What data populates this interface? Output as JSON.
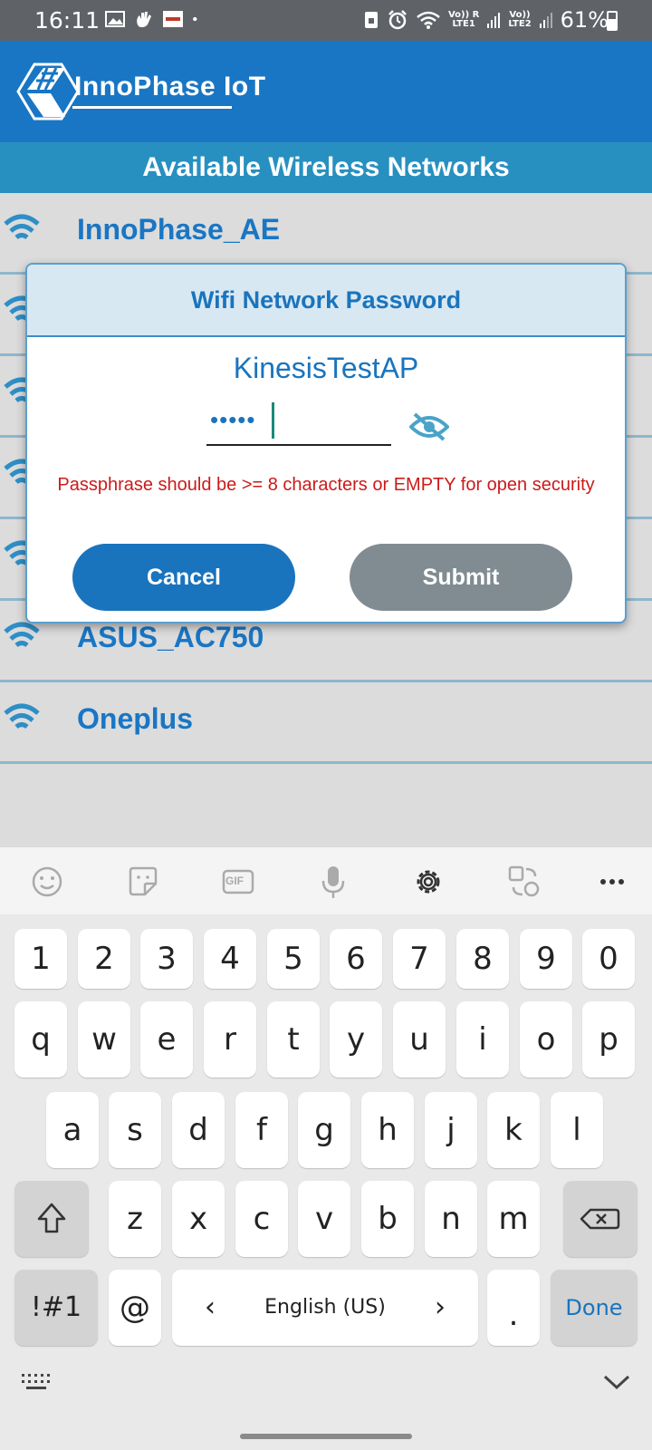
{
  "status_bar": {
    "time": "16:11",
    "net1": "Vo)) R",
    "net1_sub": "LTE1",
    "net2": "Vo))",
    "net2_sub": "LTE2",
    "battery": "61%"
  },
  "header": {
    "brand": "InnoPhase IoT",
    "section_title": "Available Wireless Networks"
  },
  "networks": [
    {
      "name": "InnoPhase_AE"
    },
    {
      "name": ""
    },
    {
      "name": ""
    },
    {
      "name": ""
    },
    {
      "name": ""
    },
    {
      "name": "ASUS_AC750"
    },
    {
      "name": "Oneplus"
    }
  ],
  "dialog": {
    "title": "Wifi Network Password",
    "ssid": "KinesisTestAP",
    "password_masked": "•••••",
    "error": "Passphrase should be >= 8 characters or EMPTY for open security",
    "cancel_label": "Cancel",
    "submit_label": "Submit"
  },
  "keyboard": {
    "toolbar_icons": [
      "emoji-icon",
      "sticker-icon",
      "gif-icon",
      "mic-icon",
      "settings-icon",
      "translate-icon",
      "more-icon"
    ],
    "gif_label": "GIF",
    "row_numbers": [
      "1",
      "2",
      "3",
      "4",
      "5",
      "6",
      "7",
      "8",
      "9",
      "0"
    ],
    "row_q": [
      "q",
      "w",
      "e",
      "r",
      "t",
      "y",
      "u",
      "i",
      "o",
      "p"
    ],
    "row_a": [
      "a",
      "s",
      "d",
      "f",
      "g",
      "h",
      "j",
      "k",
      "l"
    ],
    "row_z": [
      "z",
      "x",
      "c",
      "v",
      "b",
      "n",
      "m"
    ],
    "symbols_label": "!#1",
    "at_label": "@",
    "space_label": "English (US)",
    "space_left": "‹",
    "space_right": "›",
    "period_label": ".",
    "done_label": "Done",
    "accent_color": "#1a74bd"
  },
  "colors": {
    "app_blue": "#1976c4",
    "section_blue": "#2790c0",
    "error_red": "#cc1a1a",
    "submit_grey": "#818c92"
  }
}
